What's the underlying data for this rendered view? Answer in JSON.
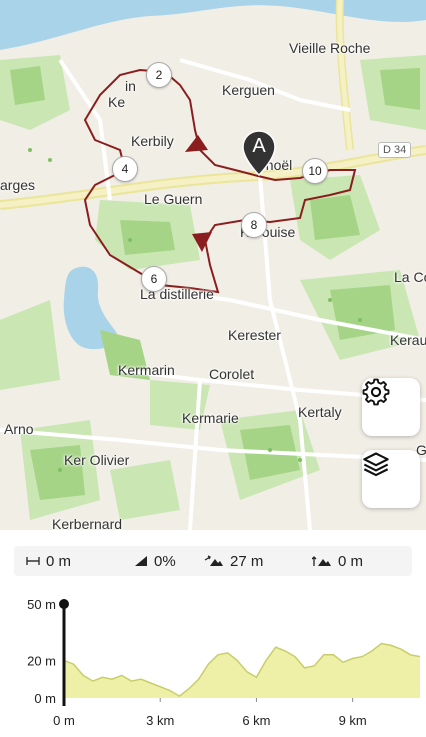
{
  "map": {
    "places": [
      {
        "id": "vieille-roche",
        "text": "Vieille Roche"
      },
      {
        "id": "kerguen",
        "text": "Kerguen"
      },
      {
        "id": "ke",
        "text": "Ke"
      },
      {
        "id": "in",
        "text": "in"
      },
      {
        "id": "kerbily",
        "text": "Kerbily"
      },
      {
        "id": "arges",
        "text": "arges"
      },
      {
        "id": "le-guern",
        "text": "Le Guern"
      },
      {
        "id": "noel",
        "text": "énoël"
      },
      {
        "id": "kerouise",
        "text": "Kerouise"
      },
      {
        "id": "la-co",
        "text": "La Co"
      },
      {
        "id": "la-distillerie",
        "text": "La distillerie"
      },
      {
        "id": "kerester",
        "text": "Kerester"
      },
      {
        "id": "kerau",
        "text": "Kerau"
      },
      {
        "id": "kermarin",
        "text": "Kermarin"
      },
      {
        "id": "corolet",
        "text": "Corolet"
      },
      {
        "id": "kermarie",
        "text": "Kermarie"
      },
      {
        "id": "kertaly",
        "text": "Kertaly"
      },
      {
        "id": "arno",
        "text": "Arno"
      },
      {
        "id": "ker-olivier",
        "text": "Ker Olivier"
      },
      {
        "id": "kerbernard",
        "text": "Kerbernard"
      },
      {
        "id": "g",
        "text": "G"
      }
    ],
    "road_shield": "D 34",
    "waypoints": [
      "2",
      "4",
      "6",
      "8",
      "10"
    ],
    "start_marker": "A",
    "icons": {
      "settings": "gear-icon",
      "layers": "layers-icon"
    }
  },
  "stats": {
    "distance": "0 m",
    "gradient": "0%",
    "ascent": "27 m",
    "descent": "0 m"
  },
  "chart_data": {
    "type": "area",
    "x": [
      0,
      0.3,
      0.6,
      0.9,
      1.2,
      1.5,
      1.8,
      2.1,
      2.4,
      2.7,
      3.0,
      3.3,
      3.6,
      3.9,
      4.2,
      4.5,
      4.8,
      5.1,
      5.4,
      5.7,
      6.0,
      6.3,
      6.6,
      6.9,
      7.2,
      7.5,
      7.8,
      8.1,
      8.4,
      8.7,
      9.0,
      9.3,
      9.6,
      9.9,
      10.2,
      10.5,
      10.8,
      11.1
    ],
    "y": [
      20,
      18,
      12,
      9,
      11,
      10,
      12,
      9,
      10,
      8,
      6,
      4,
      1,
      5,
      10,
      18,
      23,
      24,
      20,
      14,
      11,
      20,
      27,
      25,
      22,
      16,
      17,
      23,
      23,
      19,
      21,
      22,
      25,
      29,
      28,
      26,
      23,
      22
    ],
    "ylim": [
      0,
      50
    ],
    "xlim": [
      0,
      11.1
    ],
    "yticks": [
      {
        "v": 50,
        "label": "50 m"
      },
      {
        "v": 20,
        "label": "20 m"
      },
      {
        "v": 0,
        "label": "0 m"
      }
    ],
    "xticks": [
      {
        "v": 0,
        "label": "0 m"
      },
      {
        "v": 3,
        "label": "3 km"
      },
      {
        "v": 6,
        "label": "6 km"
      },
      {
        "v": 9,
        "label": "9 km"
      }
    ],
    "fill": "#eef0a8",
    "stroke": "#c8cd6a",
    "cursor_color": "#111111"
  }
}
